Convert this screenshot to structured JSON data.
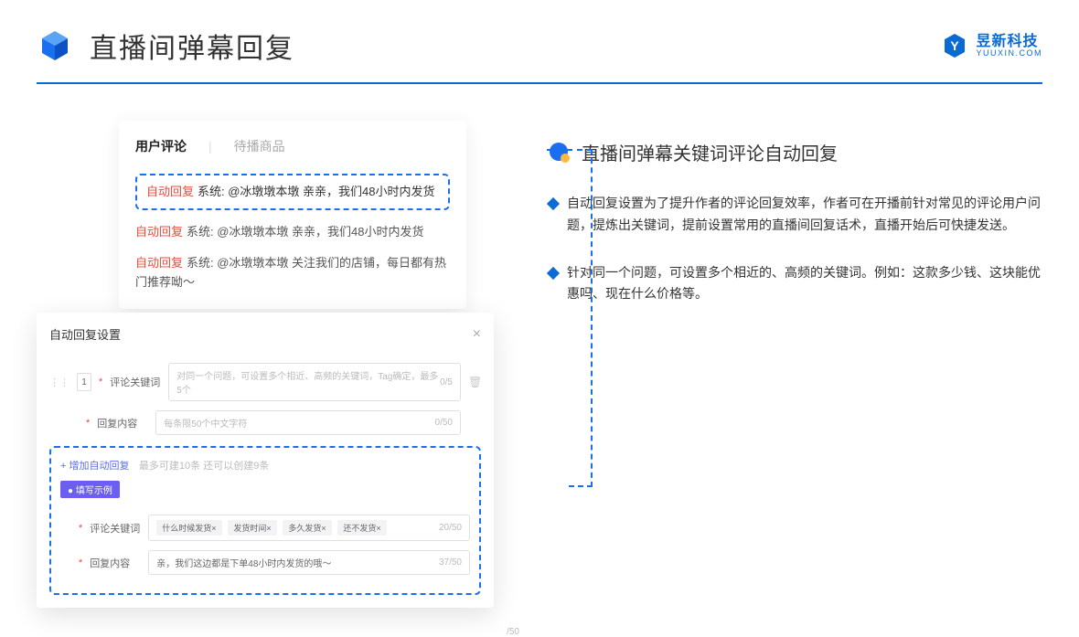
{
  "header": {
    "title": "直播间弹幕回复",
    "brand_cn": "昱新科技",
    "brand_en": "YUUXIN.COM"
  },
  "card1": {
    "tab_active": "用户评论",
    "tab_inactive": "待播商品",
    "highlight_prefix": "自动回复",
    "highlight_text": "系统: @冰墩墩本墩 亲亲，我们48小时内发货",
    "line2_prefix": "自动回复",
    "line2_text": "系统: @冰墩墩本墩 亲亲，我们48小时内发货",
    "line3_prefix": "自动回复",
    "line3_text": "系统: @冰墩墩本墩 关注我们的店铺，每日都有热门推荐呦～"
  },
  "card2": {
    "title": "自动回复设置",
    "row_num": "1",
    "kw_label": "评论关键词",
    "kw_placeholder": "对同一个问题，可设置多个相近、高频的关键词，Tag确定，最多5个",
    "kw_count": "0/5",
    "content_label": "回复内容",
    "content_placeholder": "每条限50个中文字符",
    "content_count": "0/50",
    "add_link": "+ 增加自动回复",
    "add_hint": "最多可建10条 还可以创建9条",
    "example_badge": "● 填写示例",
    "ex_kw_label": "评论关键词",
    "ex_tags": [
      "什么时候发货×",
      "发货时间×",
      "多久发货×",
      "还不发货×"
    ],
    "ex_kw_count": "20/50",
    "ex_content_label": "回复内容",
    "ex_content_value": "亲，我们这边都是下单48小时内发货的哦～",
    "ex_content_count": "37/50",
    "outside_count": "/50"
  },
  "right": {
    "section_title": "直播间弹幕关键词评论自动回复",
    "bullet1": "自动回复设置为了提升作者的评论回复效率，作者可在开播前针对常见的评论用户问题，提炼出关键词，提前设置常用的直播间回复话术，直播开始后可快捷发送。",
    "bullet2": "针对同一个问题，可设置多个相近的、高频的关键词。例如：这款多少钱、这块能优惠吗、现在什么价格等。"
  }
}
